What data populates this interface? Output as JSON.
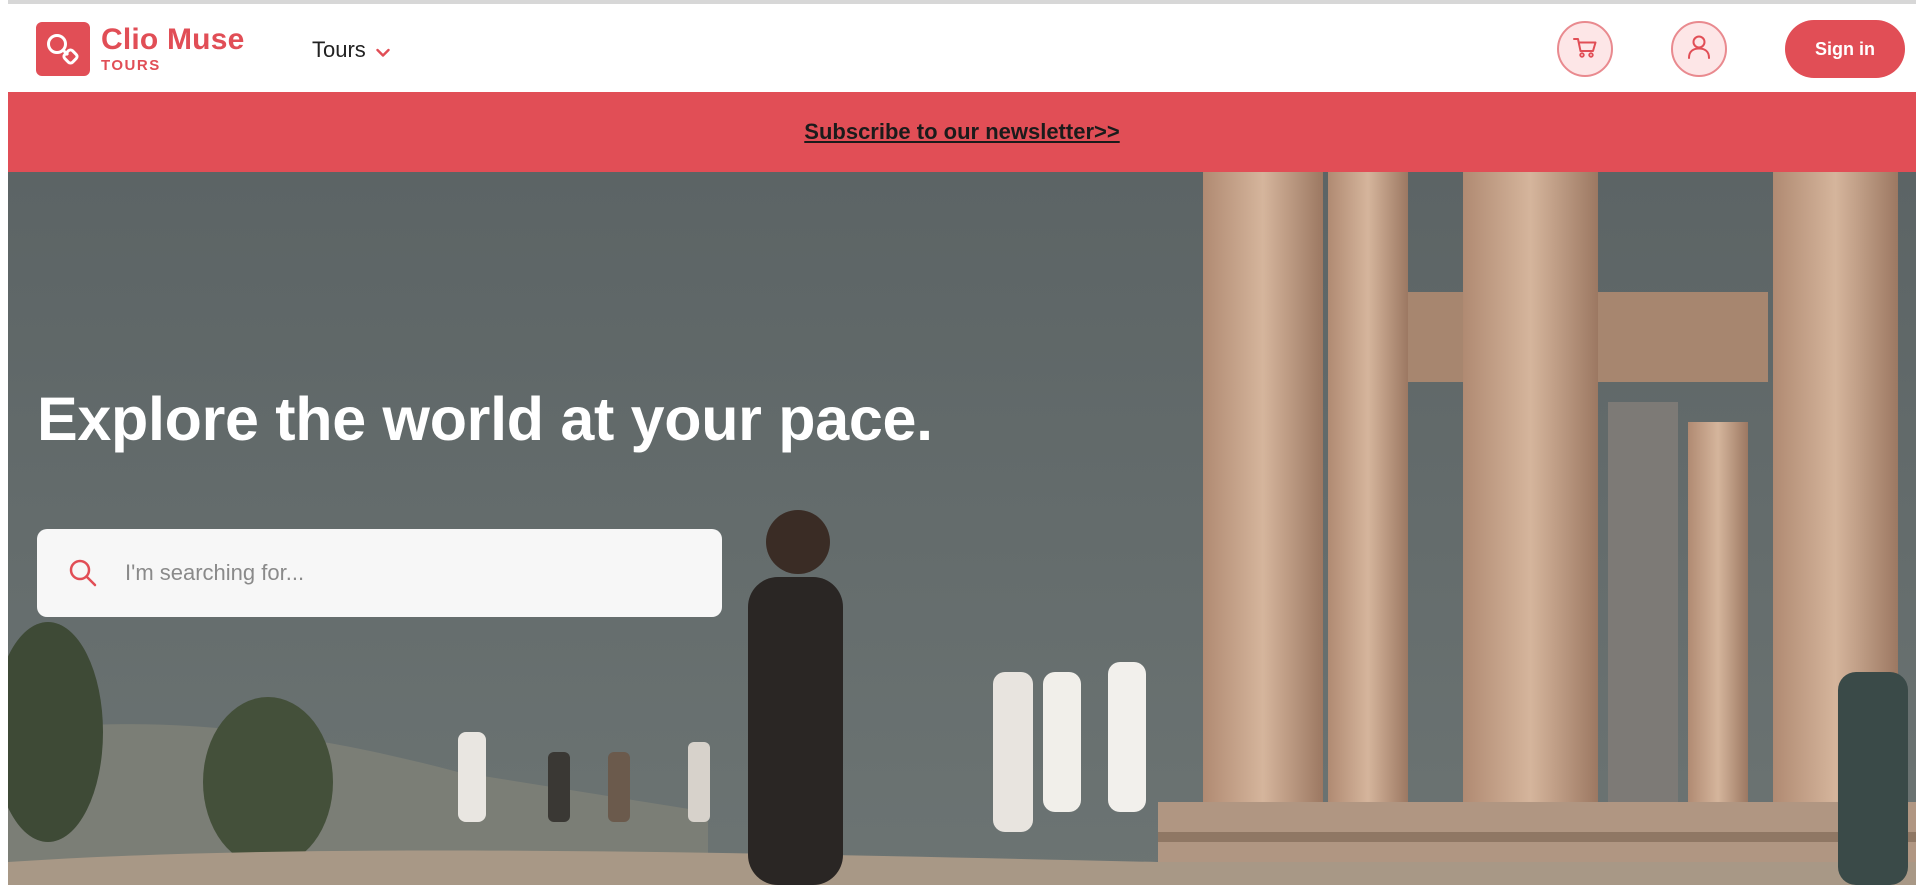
{
  "header": {
    "logo": {
      "name": "Clio Muse",
      "sub": "TOURS"
    },
    "nav": {
      "tours_label": "Tours"
    },
    "cart_icon": "cart-icon",
    "user_icon": "user-icon",
    "signin_label": "Sign in"
  },
  "banner": {
    "link_text": "Subscribe to our newsletter>>"
  },
  "hero": {
    "title": "Explore the world at your pace.",
    "search": {
      "placeholder": "I'm searching for...",
      "value": ""
    }
  },
  "colors": {
    "brand": "#e14e56",
    "brand_light": "#fde6e7",
    "hero_sky": "#5f6768"
  }
}
